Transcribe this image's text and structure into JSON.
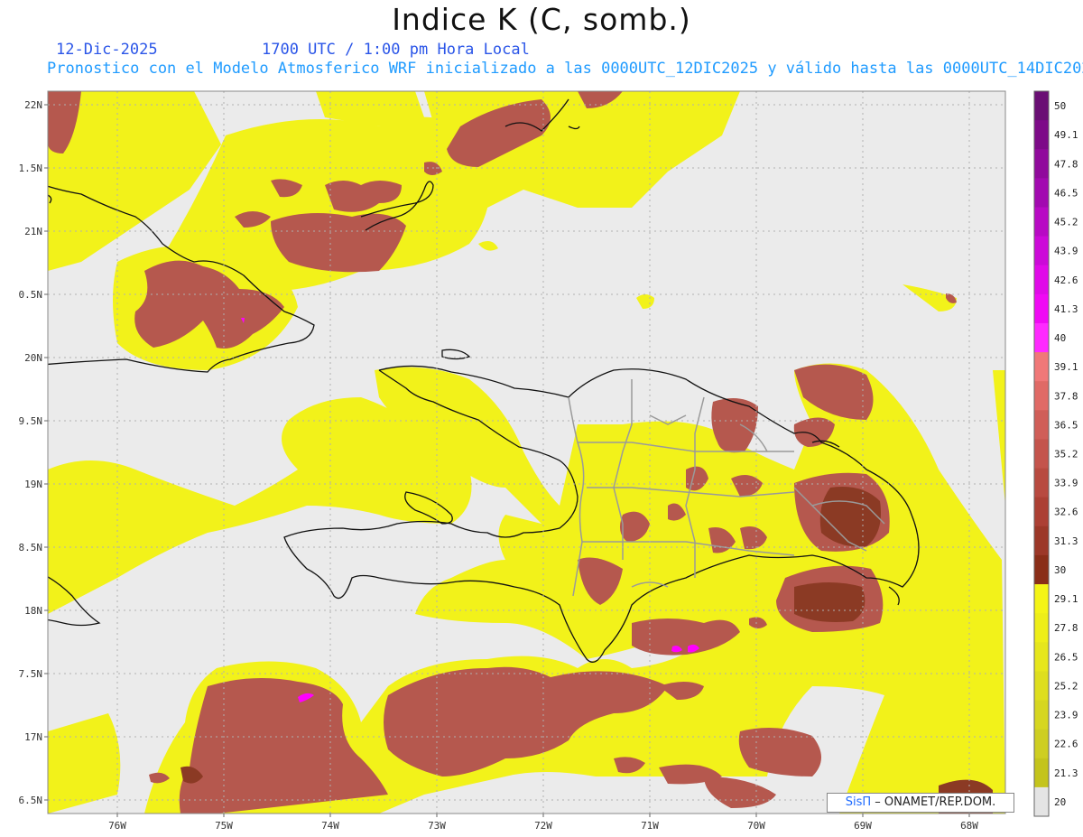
{
  "header": {
    "title": "Indice K (C, somb.)",
    "date": "12-Dic-2025",
    "time": "1700 UTC / 1:00 pm Hora Local",
    "model_line": "Pronostico con el Modelo Atmosferico WRF inicializado a las 0000UTC_12DIC2025 y válido hasta las  0000UTC_14DIC2025"
  },
  "map": {
    "lat_labels": [
      "22N",
      "1.5N",
      "21N",
      "0.5N",
      "20N",
      "9.5N",
      "19N",
      "8.5N",
      "18N",
      "7.5N",
      "17N",
      "6.5N"
    ],
    "lon_labels": [
      "76W",
      "75W",
      "74W",
      "73W",
      "72W",
      "71W",
      "70W",
      "69W",
      "68W"
    ],
    "colors": {
      "background": "#ebebeb",
      "yellow": "#f2f21a",
      "yellow_dark": "#d8d81e",
      "brown": "#b5584e",
      "brown_dark": "#8b3a24",
      "magenta": "#ff00ff"
    }
  },
  "colorbar": {
    "labels": [
      "50",
      "49.1",
      "47.8",
      "46.5",
      "45.2",
      "43.9",
      "42.6",
      "41.3",
      "40",
      "39.1",
      "37.8",
      "36.5",
      "35.2",
      "33.9",
      "32.6",
      "31.3",
      "30",
      "29.1",
      "27.8",
      "26.5",
      "25.2",
      "23.9",
      "22.6",
      "21.3",
      "20"
    ],
    "colors": [
      "#6a0f74",
      "#7d0a88",
      "#900a9c",
      "#a20ab0",
      "#b80ac4",
      "#cc0ad8",
      "#e00ae8",
      "#f00af4",
      "#ff2aff",
      "#f07878",
      "#e06a66",
      "#d05e58",
      "#c4544c",
      "#b84a40",
      "#ac4034",
      "#9c3828",
      "#8a2e18",
      "#f4f416",
      "#eeee18",
      "#e6e61c",
      "#dede1e",
      "#d6d620",
      "#cece22",
      "#c4c41c",
      "#e4e4e4"
    ]
  },
  "credit": {
    "sis": "SisΠ",
    "rest": " – ONAMET/REP.DOM."
  }
}
